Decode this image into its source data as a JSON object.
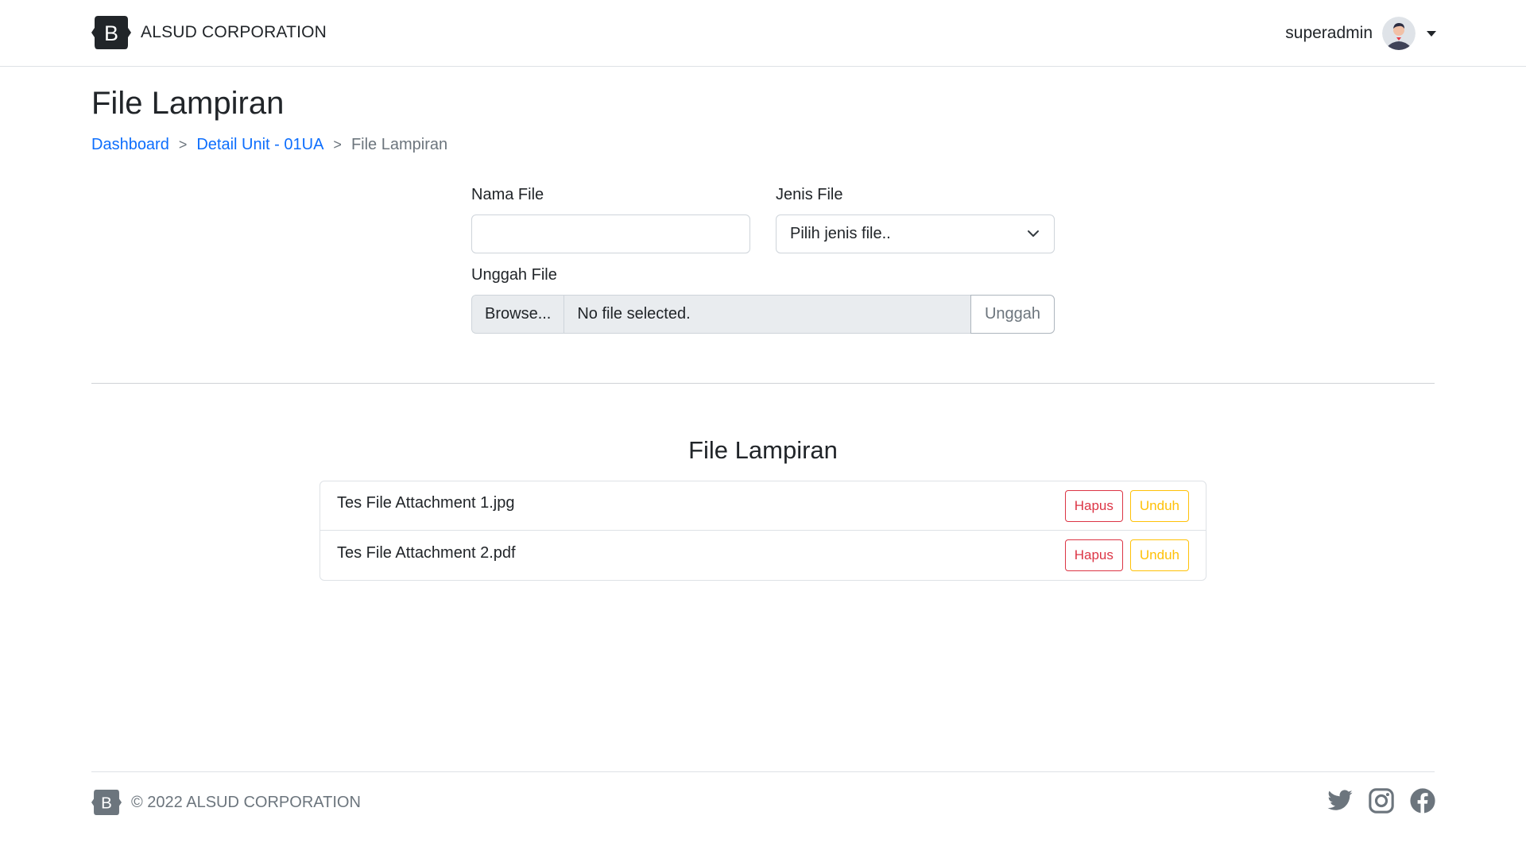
{
  "brand": {
    "logo_letter": "B",
    "name": "ALSUD CORPORATION"
  },
  "user": {
    "name": "superadmin"
  },
  "page": {
    "title": "File Lampiran"
  },
  "breadcrumb": {
    "items": [
      {
        "label": "Dashboard"
      },
      {
        "label": "Detail Unit - 01UA"
      },
      {
        "label": "File Lampiran"
      }
    ],
    "separator": ">"
  },
  "form": {
    "nama_file_label": "Nama File",
    "nama_file_value": "",
    "jenis_file_label": "Jenis File",
    "jenis_file_selected": "Pilih jenis file..",
    "unggah_label": "Unggah File",
    "browse_label": "Browse...",
    "file_status": "No file selected.",
    "upload_button": "Unggah"
  },
  "attachments": {
    "title": "File Lampiran",
    "items": [
      {
        "name": "Tes File Attachment 1.jpg",
        "delete_label": "Hapus",
        "download_label": "Unduh"
      },
      {
        "name": "Tes File Attachment 2.pdf",
        "delete_label": "Hapus",
        "download_label": "Unduh"
      }
    ]
  },
  "footer": {
    "logo_letter": "B",
    "copyright": "© 2022 ALSUD CORPORATION",
    "social": [
      "twitter-icon",
      "instagram-icon",
      "facebook-icon"
    ]
  },
  "colors": {
    "link": "#0d6efd",
    "danger": "#dc3545",
    "warning": "#ffc107",
    "muted": "#6c757d"
  }
}
